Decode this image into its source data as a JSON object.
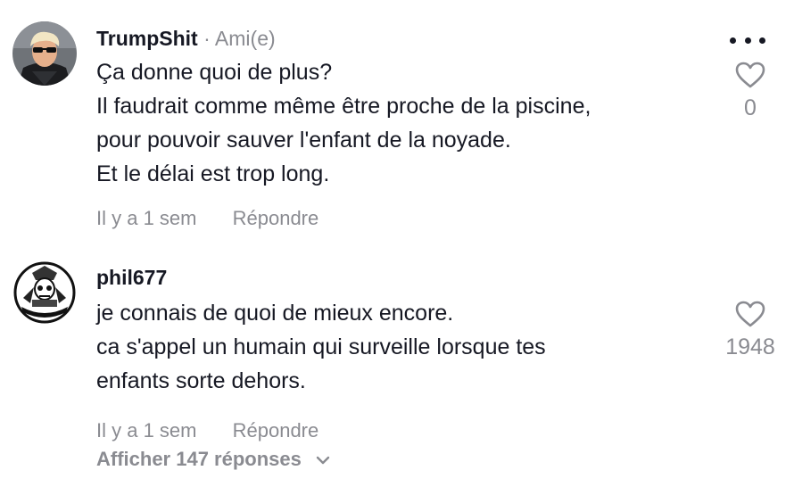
{
  "comments": [
    {
      "username": "TrumpShit",
      "separator": "·",
      "relation": "Ami(e)",
      "lines": [
        "Ça donne quoi de plus?",
        "Il faudrait comme même être proche de la piscine,",
        "pour pouvoir sauver l'enfant de la noyade.",
        "Et le délai est trop long."
      ],
      "time": "Il y a 1 sem",
      "reply_label": "Répondre",
      "likes": "0",
      "avatar_icon": "avatar-sunglasses-man"
    },
    {
      "username": "phil677",
      "lines": [
        "je connais de quoi de mieux encore.",
        "ca s'appel un humain qui surveille lorsque tes",
        "enfants sorte dehors."
      ],
      "time": "Il y a 1 sem",
      "reply_label": "Répondre",
      "likes": "1948",
      "avatar_icon": "avatar-skull-emblem"
    }
  ],
  "view_replies": "Afficher 147 réponses",
  "icons": {
    "more": "more-dots-icon",
    "like": "heart-outline-icon",
    "expand": "chevron-down-icon"
  },
  "colors": {
    "text": "#161823",
    "secondary": "#8a8b91"
  }
}
